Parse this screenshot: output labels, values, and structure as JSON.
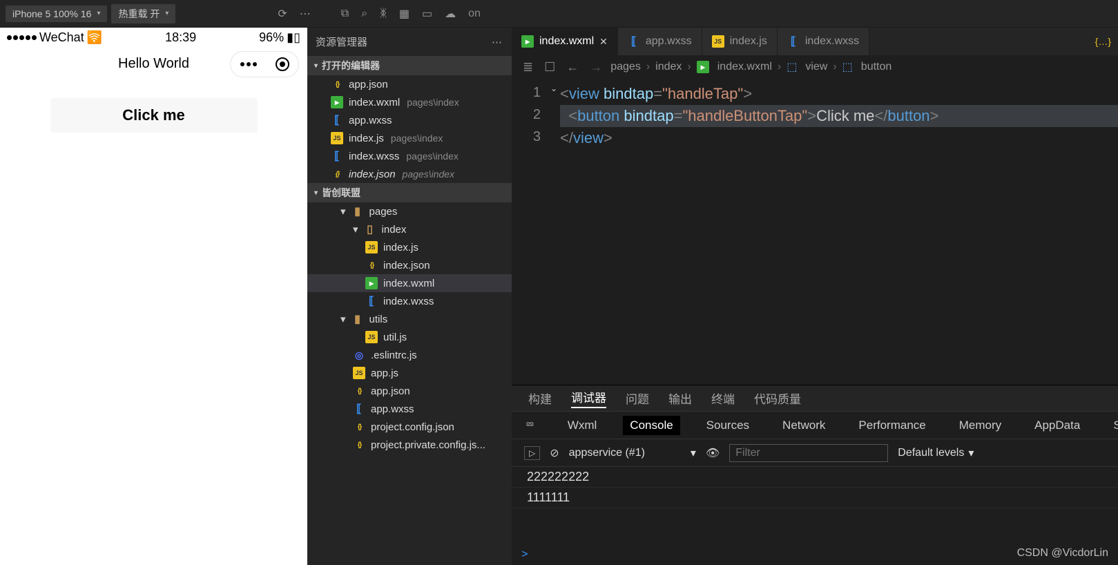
{
  "topbar": {
    "device": "iPhone 5 100% 16",
    "reload": "热重载 开",
    "ext": "on"
  },
  "simulator": {
    "carrier": "WeChat",
    "time": "18:39",
    "battery": "96%",
    "title": "Hello World",
    "button": "Click me"
  },
  "explorer": {
    "title": "资源管理器",
    "open_editors": "打开的编辑器",
    "project": "皆创联盟",
    "open": [
      {
        "name": "app.json",
        "type": "json"
      },
      {
        "name": "index.wxml",
        "hint": "pages\\index",
        "type": "wxml"
      },
      {
        "name": "app.wxss",
        "type": "wxss"
      },
      {
        "name": "index.js",
        "hint": "pages\\index",
        "type": "js"
      },
      {
        "name": "index.wxss",
        "hint": "pages\\index",
        "type": "wxss"
      },
      {
        "name": "index.json",
        "hint": "pages\\index",
        "type": "json",
        "italic": true
      }
    ],
    "tree": {
      "pages": "pages",
      "index": "index",
      "files": [
        {
          "name": "index.js",
          "type": "js"
        },
        {
          "name": "index.json",
          "type": "json"
        },
        {
          "name": "index.wxml",
          "type": "wxml",
          "sel": true
        },
        {
          "name": "index.wxss",
          "type": "wxss"
        }
      ],
      "utils": "utils",
      "util": "util.js",
      "root": [
        {
          "name": ".eslintrc.js",
          "type": "eslint"
        },
        {
          "name": "app.js",
          "type": "js"
        },
        {
          "name": "app.json",
          "type": "json"
        },
        {
          "name": "app.wxss",
          "type": "wxss"
        },
        {
          "name": "project.config.json",
          "type": "json"
        },
        {
          "name": "project.private.config.js...",
          "type": "json"
        }
      ]
    }
  },
  "tabs": [
    {
      "name": "index.wxml",
      "type": "wxml",
      "active": true,
      "close": true
    },
    {
      "name": "app.wxss",
      "type": "wxss"
    },
    {
      "name": "index.js",
      "type": "js"
    },
    {
      "name": "index.wxss",
      "type": "wxss"
    }
  ],
  "breadcrumb": [
    "pages",
    "index",
    "index.wxml",
    "view",
    "button"
  ],
  "code": {
    "lines": [
      {
        "n": "1",
        "html": "<span class='t-pun'>&lt;</span><span class='t-tag'>view</span> <span class='t-attr'>bindtap</span><span class='t-pun'>=</span><span class='t-str'>\"handleTap\"</span><span class='t-pun'>&gt;</span>"
      },
      {
        "n": "2",
        "html": "  <span class='t-pun'>&lt;</span><span class='t-tag'>button</span> <span class='t-attr'>bindtap</span><span class='t-pun'>=</span><span class='t-str'>\"handleButtonTap\"</span><span class='t-pun'>&gt;</span>Click me<span class='t-pun'>&lt;/</span><span class='t-tag'>button</span><span class='t-pun'>&gt;</span>",
        "hl": true
      },
      {
        "n": "3",
        "html": "<span class='t-pun'>&lt;/</span><span class='t-tag'>view</span><span class='t-pun'>&gt;</span>"
      }
    ]
  },
  "panel": {
    "tabs": [
      "构建",
      "调试器",
      "问题",
      "输出",
      "终端",
      "代码质量"
    ],
    "active_tab": "调试器",
    "devtabs": [
      "Wxml",
      "Console",
      "Sources",
      "Network",
      "Performance",
      "Memory",
      "AppData",
      "Storag"
    ],
    "active_dev": "Console",
    "context": "appservice (#1)",
    "filter_ph": "Filter",
    "levels": "Default levels",
    "logs": [
      "222222222",
      "1111111"
    ],
    "prompt": ">"
  },
  "watermark": "CSDN @VicdorLin"
}
